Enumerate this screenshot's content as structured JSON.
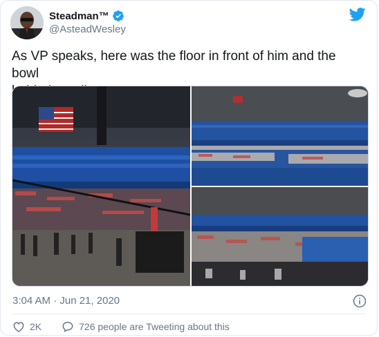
{
  "tweet": {
    "author_name": "Steadman™",
    "handle": "@AsteadWesley",
    "text": "As VP speaks, here was the floor in front of him and the bowl\nbehind  media",
    "timestamp": "3:04 AM · Jun 21, 2020",
    "like_count": "2K",
    "reply_text": "726 people are Tweeting about this",
    "verified": true
  },
  "media": [
    {
      "name": "arena-floor-photo",
      "icon": "photo"
    },
    {
      "name": "arena-bowl-photo-top",
      "icon": "photo"
    },
    {
      "name": "arena-bowl-photo-bottom",
      "icon": "photo"
    }
  ],
  "colors": {
    "brand": "#1da1f2",
    "text_secondary": "#657786",
    "text_primary": "#14171a",
    "seat_blue": "#1f55a8"
  },
  "icons": {
    "verified": "verified-badge-icon",
    "logo": "twitter-bird-icon",
    "info": "info-icon",
    "like": "heart-icon",
    "reply": "speech-bubble-icon"
  }
}
